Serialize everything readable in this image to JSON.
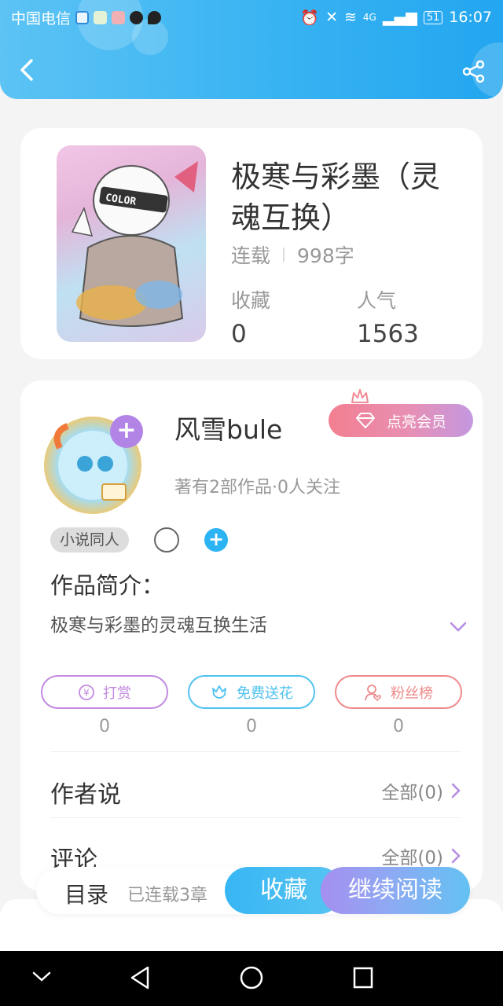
{
  "status_bar": {
    "carrier": "中国电信",
    "network": "4G",
    "battery": "51",
    "time": "16:07"
  },
  "header": {
    "back_icon": "back-arrow-icon",
    "share_icon": "share-icon"
  },
  "book": {
    "title": "极寒与彩墨（灵魂互换）",
    "status": "连载",
    "word_count": "998字",
    "collect_label": "收藏",
    "collect_value": "0",
    "popularity_label": "人气",
    "popularity_value": "1563",
    "cover_text": "COLOR"
  },
  "author": {
    "name": "风雪bule",
    "vip_button": "点亮会员",
    "works_info": "著有2部作品·0人关注",
    "tag": "小说同人",
    "intro_heading": "作品简介：",
    "intro_text": "极寒与彩墨的灵魂互换生活"
  },
  "actions": [
    {
      "label": "打赏",
      "count": "0",
      "color": "#c28ae0"
    },
    {
      "label": "免费送花",
      "count": "0",
      "color": "#4fc2ef"
    },
    {
      "label": "粉丝榜",
      "count": "0",
      "color": "#ee8a8a"
    }
  ],
  "sections": {
    "author_says_label": "作者说",
    "author_says_all": "全部(0)",
    "comments_label": "评论",
    "comments_all": "全部(0)"
  },
  "bottom_bar": {
    "toc": "目录",
    "toc_sub": "已连载3章",
    "collect": "收藏",
    "continue_reading": "继续阅读"
  },
  "colors": {
    "header_blue": "#38b3f2",
    "vip_gradient_start": "#f27f90",
    "vip_gradient_end": "#c498e0",
    "accent_blue": "#2bb3f3"
  }
}
